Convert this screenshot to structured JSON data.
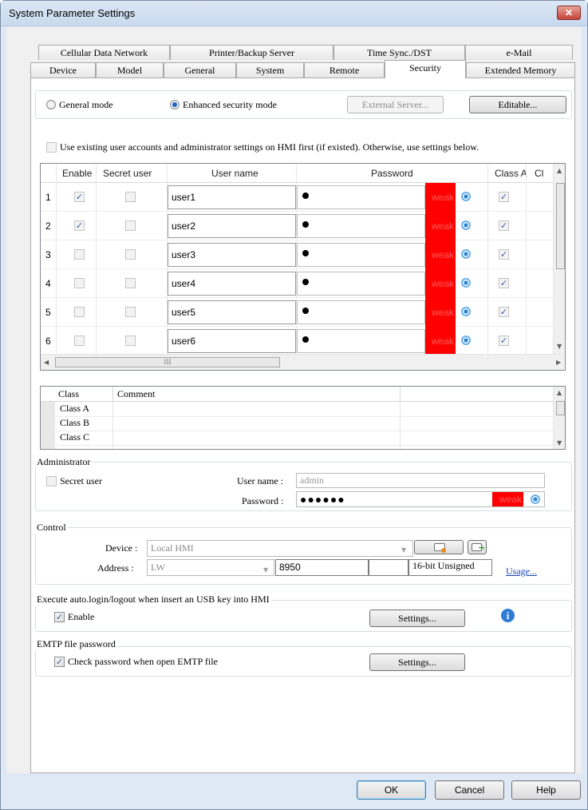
{
  "window": {
    "title": "System Parameter Settings",
    "close_glyph": "✕"
  },
  "tabs_row1": [
    "Cellular Data Network",
    "Printer/Backup Server",
    "Time Sync./DST",
    "e-Mail"
  ],
  "tabs_row2": [
    "Device",
    "Model",
    "General",
    "System",
    "Remote",
    "Security",
    "Extended Memory"
  ],
  "mode": {
    "general_label": "General mode",
    "enhanced_label": "Enhanced security mode",
    "selected": "enhanced",
    "external_server_label": "External Server...",
    "editable_label": "Editable..."
  },
  "use_existing": {
    "label": "Use existing user accounts and administrator settings on HMI first (if existed). Otherwise, use settings below.",
    "checked": false
  },
  "user_table": {
    "columns": [
      "Enable",
      "Secret user",
      "User name",
      "Password",
      "Class A",
      "Cl"
    ],
    "strength_label": "weak",
    "rows": [
      {
        "num": "1",
        "enable": true,
        "secret": false,
        "name": "user1",
        "classA": true
      },
      {
        "num": "2",
        "enable": true,
        "secret": false,
        "name": "user2",
        "classA": true
      },
      {
        "num": "3",
        "enable": false,
        "secret": false,
        "name": "user3",
        "classA": true
      },
      {
        "num": "4",
        "enable": false,
        "secret": false,
        "name": "user4",
        "classA": true
      },
      {
        "num": "5",
        "enable": false,
        "secret": false,
        "name": "user5",
        "classA": true
      },
      {
        "num": "6",
        "enable": false,
        "secret": false,
        "name": "user6",
        "classA": true
      }
    ],
    "hscroll_grip": "III"
  },
  "class_table": {
    "columns": [
      "Class",
      "Comment"
    ],
    "rows": [
      "Class A",
      "Class B",
      "Class C"
    ]
  },
  "administrator": {
    "group_label": "Administrator",
    "secret_user_label": "Secret user",
    "username_label": "User name :",
    "username_value": "admin",
    "password_label": "Password :",
    "password_value": "●●●●●●",
    "strength_label": "weak"
  },
  "control": {
    "group_label": "Control",
    "device_label": "Device :",
    "device_value": "Local HMI",
    "address_label": "Address :",
    "address_type": "LW",
    "address_value": "8950",
    "data_type": "16-bit Unsigned",
    "usage_link": "Usage..."
  },
  "usb": {
    "group_label": "Execute auto.login/logout when insert an USB key into HMI",
    "enable_label": "Enable",
    "enable_checked": true,
    "settings_label": "Settings...",
    "info_glyph": "i"
  },
  "emtp": {
    "group_label": "EMTP file password",
    "check_label": "Check password when open EMTP file",
    "check_checked": true,
    "settings_label": "Settings..."
  },
  "footer": {
    "ok": "OK",
    "cancel": "Cancel",
    "help": "Help"
  }
}
